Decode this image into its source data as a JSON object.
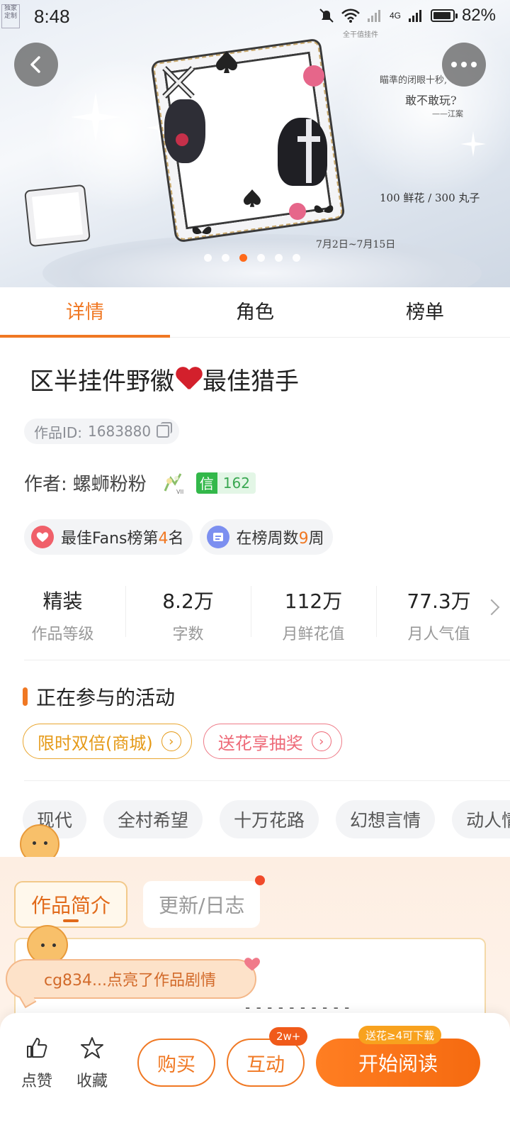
{
  "status_bar": {
    "time": "8:48",
    "battery": "82%",
    "network": "4G",
    "logo_text": "独家定制"
  },
  "banner": {
    "slogan_line1": "瞄準的闭眼十秒,",
    "slogan_line2": "敢不敢玩?",
    "slogan_author": "——江案",
    "price_text": "100 鲜花 / 300 丸子",
    "date_text": "7月2日~7月15日",
    "label_top": "全干值挂件",
    "slide_count": 6,
    "active_slide": 3
  },
  "tabs": [
    {
      "label": "详情",
      "active": true
    },
    {
      "label": "角色",
      "active": false
    },
    {
      "label": "榜单",
      "active": false
    }
  ],
  "work": {
    "title_before": "区半挂件野徽",
    "title_after": "最佳猎手",
    "id_label": "作品ID:",
    "id_value": "1683880"
  },
  "author": {
    "label": "作者:",
    "name": "螺蛳粉粉",
    "trust_icon": "信",
    "trust_value": "162"
  },
  "ranking_chips": [
    {
      "prefix": "最佳Fans榜第",
      "highlight": "4",
      "suffix": "名",
      "icon": "fans-heart-icon"
    },
    {
      "prefix": "在榜周数",
      "highlight": "9",
      "suffix": "周",
      "icon": "list-icon"
    }
  ],
  "stats": [
    {
      "value": "精装",
      "label": "作品等级"
    },
    {
      "value": "8.2万",
      "label": "字数"
    },
    {
      "value": "112万",
      "label": "月鲜花值"
    },
    {
      "value": "77.3万",
      "label": "月人气值"
    }
  ],
  "activities_section": {
    "title": "正在参与的活动",
    "items": [
      {
        "label": "限时双倍(商城)",
        "style": "gold"
      },
      {
        "label": "送花享抽奖",
        "style": "pink"
      }
    ]
  },
  "genre_tags": [
    "现代",
    "全村希望",
    "十万花路",
    "幻想言情",
    "动人情"
  ],
  "sub_tabs": [
    {
      "label": "作品简介",
      "active": true
    },
    {
      "label": "更新/日志",
      "active": false
    }
  ],
  "intro_dashes": "- - - - - - - - - -",
  "toast": {
    "text": "cg834...点亮了作品剧情"
  },
  "bottom_bar": {
    "like_label": "点赞",
    "favorite_label": "收藏",
    "buy_label": "购买",
    "interact_label": "互动",
    "interact_badge": "2w+",
    "read_label": "开始阅读",
    "read_badge": "送花≥4可下载"
  },
  "colors": {
    "accent": "#f07823",
    "gold": "#e59a18",
    "pink": "#ee6a78",
    "trust_green": "#33b84a"
  }
}
